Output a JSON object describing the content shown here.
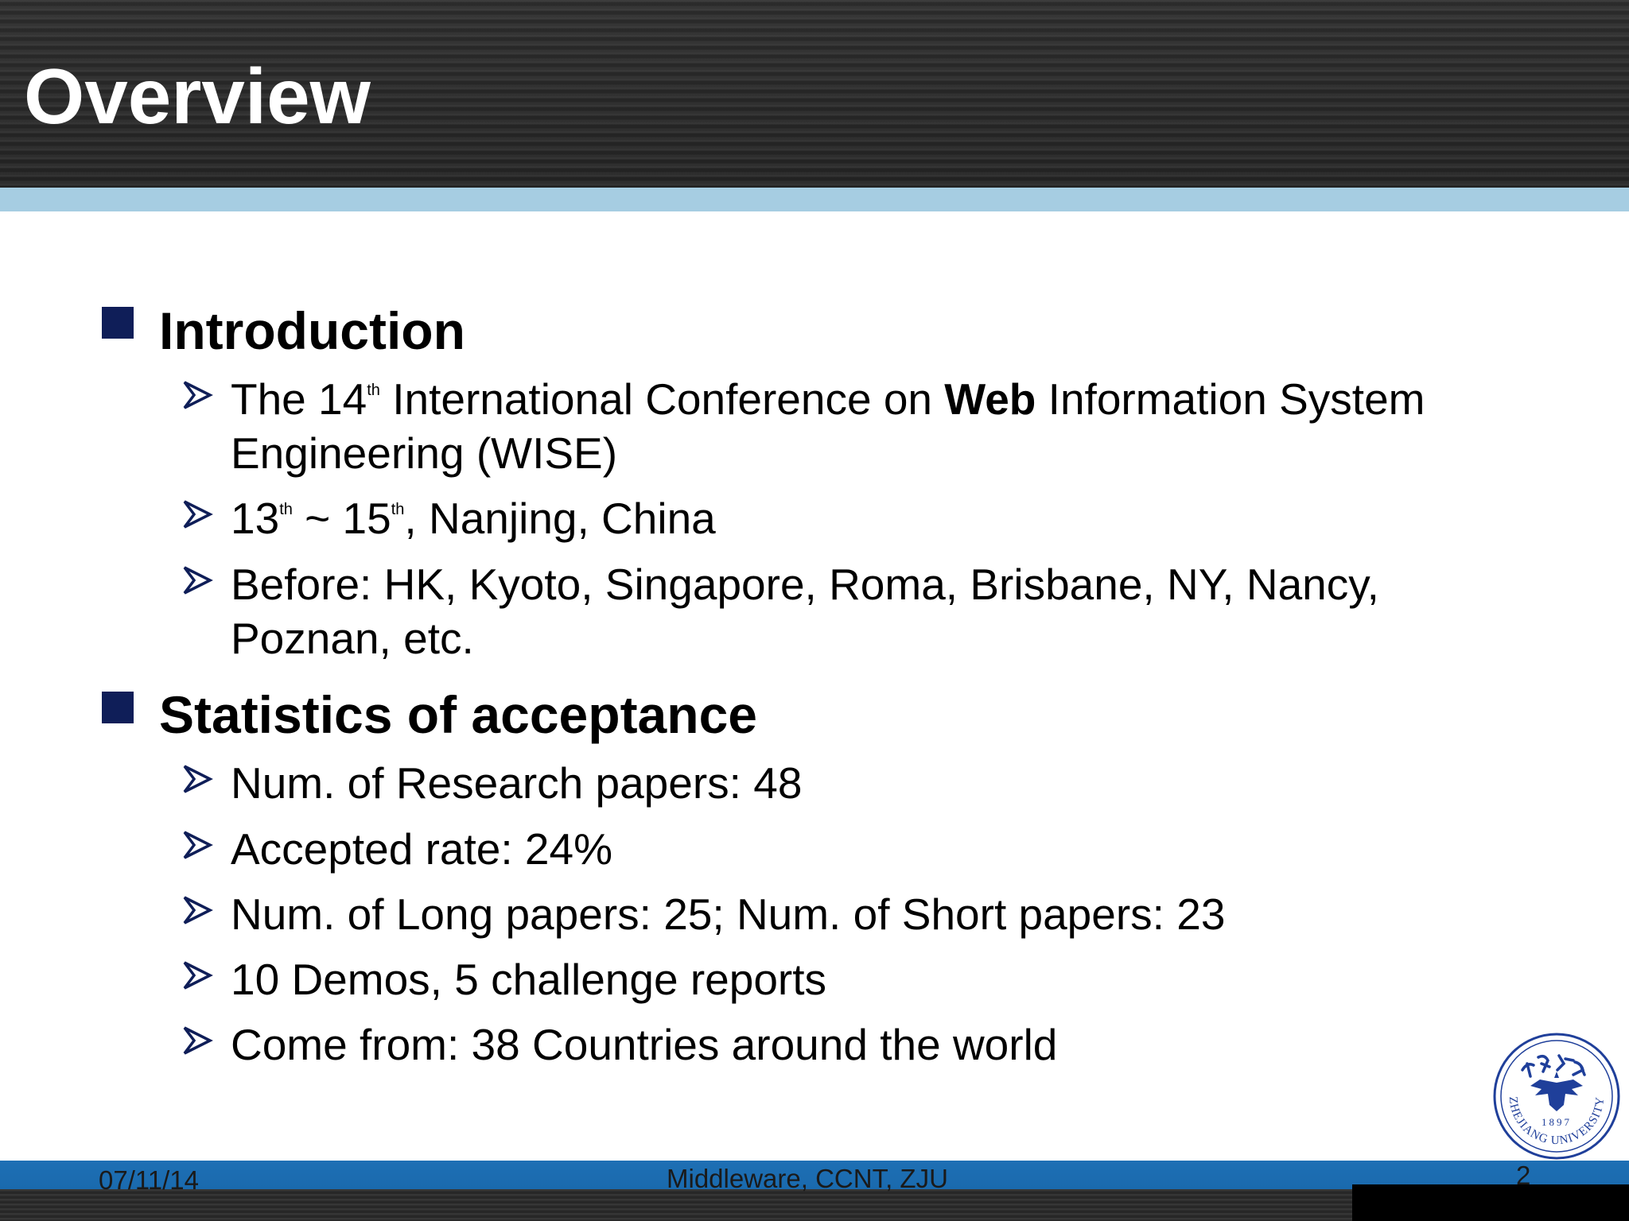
{
  "slide": {
    "title": "Overview"
  },
  "sections": [
    {
      "title": "Introduction",
      "items": [
        {
          "parts": [
            {
              "text": "The 14"
            },
            {
              "text": "th",
              "sup": true
            },
            {
              "text": " International Conference on "
            },
            {
              "text": "Web",
              "bold": true
            },
            {
              "text": " Information System"
            }
          ],
          "continuation": "Engineering (WISE)"
        },
        {
          "parts": [
            {
              "text": "13"
            },
            {
              "text": "th",
              "sup": true
            },
            {
              "text": " ~ 15"
            },
            {
              "text": "th",
              "sup": true
            },
            {
              "text": ", Nanjing, China"
            }
          ]
        },
        {
          "parts": [
            {
              "text": "Before: HK, Kyoto, Singapore, Roma, Brisbane, NY, Nancy,"
            }
          ],
          "continuation": "Poznan, etc."
        }
      ]
    },
    {
      "title": "Statistics of acceptance",
      "items": [
        {
          "parts": [
            {
              "text": "Num. of Research papers: 48"
            }
          ]
        },
        {
          "parts": [
            {
              "text": "Accepted rate: 24%"
            }
          ]
        },
        {
          "parts": [
            {
              "text": "Num. of Long papers: 25; Num. of Short papers: 23"
            }
          ]
        },
        {
          "parts": [
            {
              "text": "10 Demos, 5 challenge reports"
            }
          ]
        },
        {
          "parts": [
            {
              "text": "Come from: 38 Countries around the world"
            }
          ]
        }
      ]
    }
  ],
  "footer": {
    "date": "07/11/14",
    "center": "Middleware, CCNT, ZJU",
    "page_number": "2"
  },
  "logo": {
    "name": "zhejiang-university-seal",
    "text": "ZHEJIANG UNIVERSITY",
    "year": "1897",
    "color": "#1f3f9a"
  },
  "colors": {
    "header": "#2a2a2a",
    "header_band": "#a6cde2",
    "bullet": "#0f1e58",
    "footer_band": "#1e6fb4"
  }
}
